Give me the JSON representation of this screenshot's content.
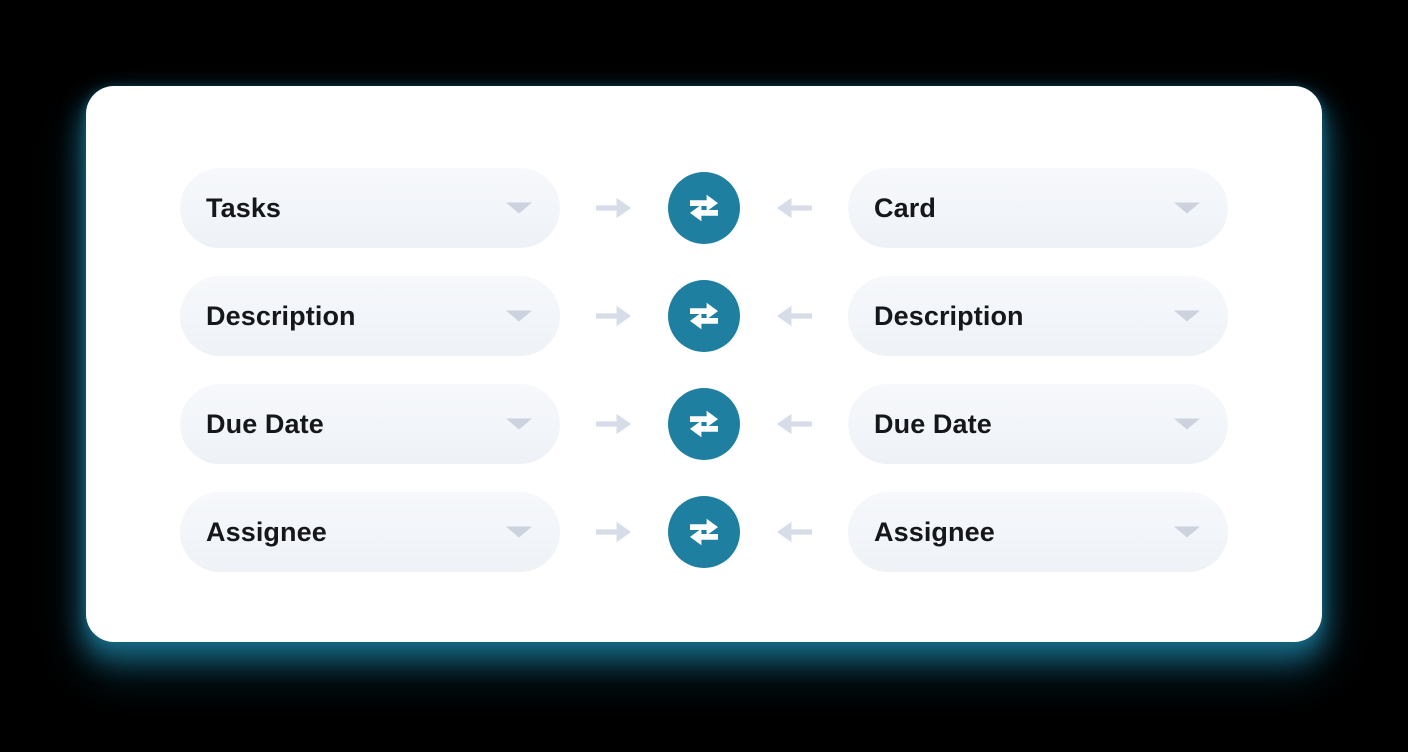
{
  "card": {
    "background": "#ffffff",
    "shadow_color": "#176883"
  },
  "theme": {
    "accent": "#1f7fa0",
    "pill_background": "#f2f5f9",
    "caret_color": "#ccd3de",
    "arrow_color": "#d6dde8",
    "text_color": "#15171a"
  },
  "mapping_rows": [
    {
      "source": {
        "value": "Tasks",
        "caret_icon": "chevron-down-icon"
      },
      "arrow_right_icon": "arrow-right-icon",
      "swap_icon": "swap-horizontal-icon",
      "arrow_left_icon": "arrow-left-icon",
      "target": {
        "value": "Card",
        "caret_icon": "chevron-down-icon"
      }
    },
    {
      "source": {
        "value": "Description",
        "caret_icon": "chevron-down-icon"
      },
      "arrow_right_icon": "arrow-right-icon",
      "swap_icon": "swap-horizontal-icon",
      "arrow_left_icon": "arrow-left-icon",
      "target": {
        "value": "Description",
        "caret_icon": "chevron-down-icon"
      }
    },
    {
      "source": {
        "value": "Due Date",
        "caret_icon": "chevron-down-icon"
      },
      "arrow_right_icon": "arrow-right-icon",
      "swap_icon": "swap-horizontal-icon",
      "arrow_left_icon": "arrow-left-icon",
      "target": {
        "value": "Due Date",
        "caret_icon": "chevron-down-icon"
      }
    },
    {
      "source": {
        "value": "Assignee",
        "caret_icon": "chevron-down-icon"
      },
      "arrow_right_icon": "arrow-right-icon",
      "swap_icon": "swap-horizontal-icon",
      "arrow_left_icon": "arrow-left-icon",
      "target": {
        "value": "Assignee",
        "caret_icon": "chevron-down-icon"
      }
    }
  ]
}
